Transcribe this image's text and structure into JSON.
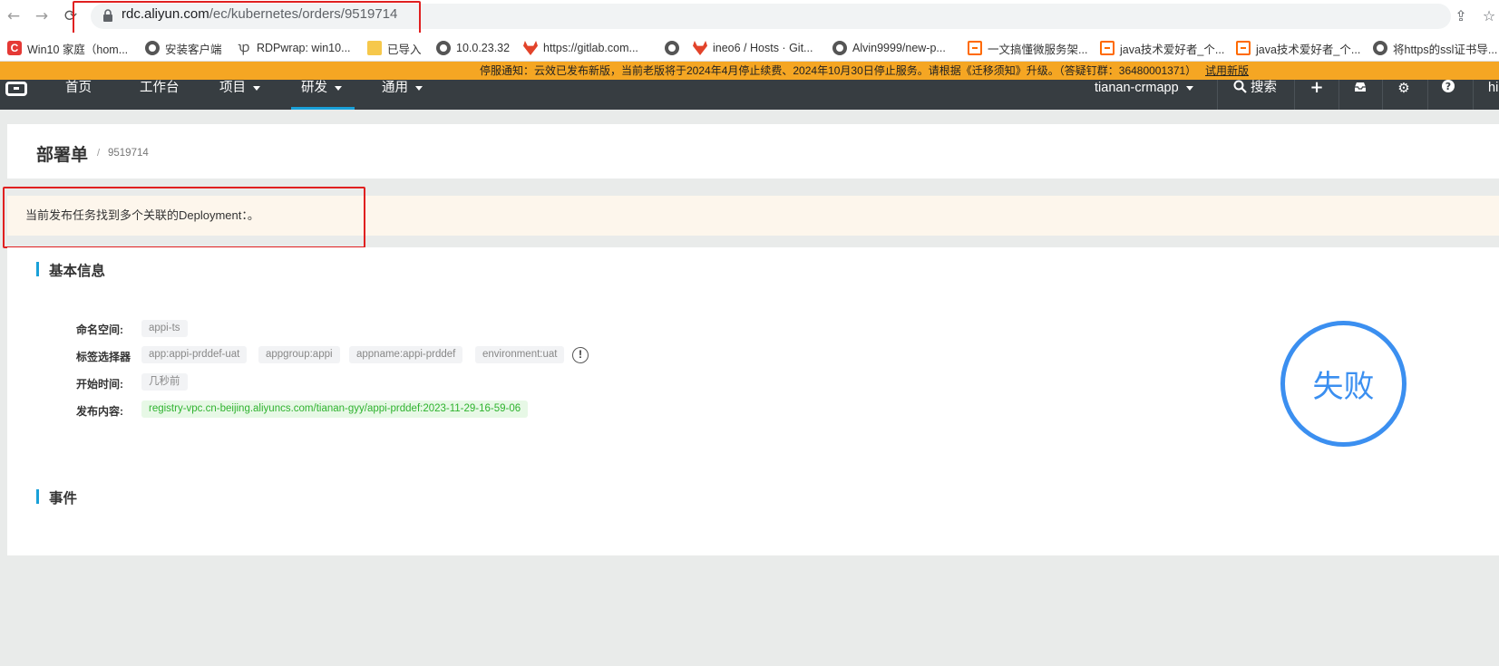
{
  "browser": {
    "url_domain": "rdc.aliyun.com",
    "url_path": "/ec/kubernetes/orders/9519714",
    "bookmarks": [
      {
        "label": "Win10 家庭（hom...",
        "icon": "c-icon"
      },
      {
        "label": "安装客户端",
        "icon": "globe-icon"
      },
      {
        "label": "RDPwrap: win10...",
        "icon": "rdp-icon"
      },
      {
        "label": "已导入",
        "icon": "folder-icon"
      },
      {
        "label": "10.0.23.32",
        "icon": "globe-icon"
      },
      {
        "label": "https://gitlab.com...",
        "icon": "gitlab-icon"
      },
      {
        "label": "",
        "icon": "globe-icon"
      },
      {
        "label": "ineo6 / Hosts · Git...",
        "icon": "gitlab-icon"
      },
      {
        "label": "Alvin9999/new-p...",
        "icon": "globe-icon"
      },
      {
        "label": "一文搞懂微服务架...",
        "icon": "aliyun-icon"
      },
      {
        "label": "java技术爱好者_个...",
        "icon": "aliyun-icon"
      },
      {
        "label": "java技术爱好者_个...",
        "icon": "aliyun-icon"
      },
      {
        "label": "将https的ssl证书导...",
        "icon": "globe-icon"
      }
    ]
  },
  "notice": {
    "text": "停服通知：云效已发布新版，当前老版将于2024年4月停止续费、2024年10月30日停止服务。请根据《迁移须知》升级。（答疑钉群：36480001371）",
    "link": "试用新版"
  },
  "nav": {
    "items": [
      {
        "label": "首页",
        "caret": false
      },
      {
        "label": "工作台",
        "caret": false
      },
      {
        "label": "项目",
        "caret": true
      },
      {
        "label": "研发",
        "caret": true
      },
      {
        "label": "通用",
        "caret": true
      }
    ],
    "project": "tianan-crmapp",
    "search": "搜索",
    "user_initial": "hi"
  },
  "page": {
    "title": "部署单",
    "sep": "/",
    "order_id": "9519714"
  },
  "alert": {
    "text": "当前发布任务找到多个关联的Deployment：。"
  },
  "basic": {
    "section_title": "基本信息",
    "namespace_label": "命名空间:",
    "namespace": "appi-ts",
    "selector_label": "标签选择器",
    "selectors": [
      "app:appi-prddef-uat",
      "appgroup:appi",
      "appname:appi-prddef",
      "environment:uat"
    ],
    "info_icon": "!",
    "start_label": "开始时间:",
    "start_value": "几秒前",
    "content_label": "发布内容:",
    "content_value": "registry-vpc.cn-beijing.aliyuncs.com/tianan-gyy/appi-prddef:2023-11-29-16-59-06",
    "status": "失败"
  },
  "events": {
    "section_title": "事件"
  },
  "colors": {
    "accent": "#19a0d8",
    "notice_bg": "#f5a623",
    "nav_bg": "#373d41",
    "fail": "#3b8ff0",
    "highlight_box": "#e02020"
  }
}
